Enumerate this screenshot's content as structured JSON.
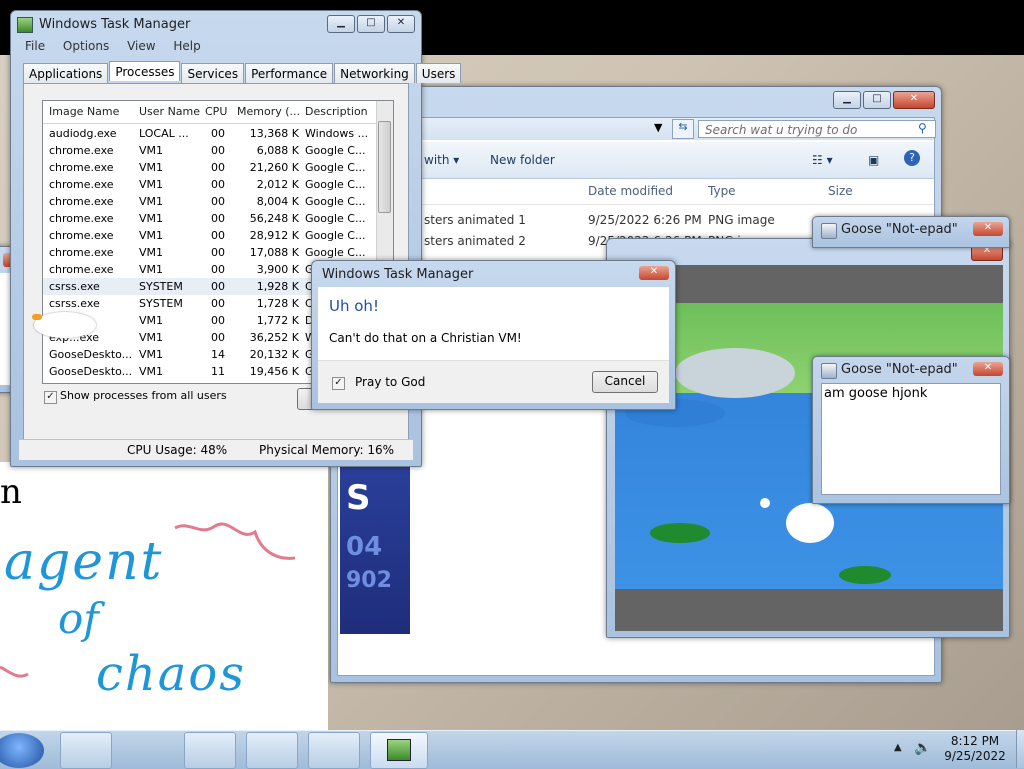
{
  "taskmgr": {
    "title": "Windows Task Manager",
    "menu": [
      "File",
      "Options",
      "View",
      "Help"
    ],
    "tabs": [
      "Applications",
      "Processes",
      "Services",
      "Performance",
      "Networking",
      "Users"
    ],
    "columns": [
      "Image Name",
      "User Name",
      "CPU",
      "Memory (...",
      "Description"
    ],
    "rows": [
      [
        "audiodg.exe",
        "LOCAL ...",
        "00",
        "13,368 K",
        "Windows ..."
      ],
      [
        "chrome.exe",
        "VM1",
        "00",
        "6,088 K",
        "Google C..."
      ],
      [
        "chrome.exe",
        "VM1",
        "00",
        "21,260 K",
        "Google C..."
      ],
      [
        "chrome.exe",
        "VM1",
        "00",
        "2,012 K",
        "Google C..."
      ],
      [
        "chrome.exe",
        "VM1",
        "00",
        "8,004 K",
        "Google C..."
      ],
      [
        "chrome.exe",
        "VM1",
        "00",
        "56,248 K",
        "Google C..."
      ],
      [
        "chrome.exe",
        "VM1",
        "00",
        "28,912 K",
        "Google C..."
      ],
      [
        "chrome.exe",
        "VM1",
        "00",
        "17,088 K",
        "Google C..."
      ],
      [
        "chrome.exe",
        "VM1",
        "00",
        "3,900 K",
        "G"
      ],
      [
        "csrss.exe",
        "SYSTEM",
        "00",
        "1,928 K",
        "C"
      ],
      [
        "csrss.exe",
        "SYSTEM",
        "00",
        "1,728 K",
        "C"
      ],
      [
        "",
        "VM1",
        "00",
        "1,772 K",
        "D"
      ],
      [
        "exp...exe",
        "VM1",
        "00",
        "36,252 K",
        "W"
      ],
      [
        "GooseDeskto...",
        "VM1",
        "14",
        "20,132 K",
        "G"
      ],
      [
        "GooseDeskto...",
        "VM1",
        "11",
        "19,456 K",
        "G"
      ]
    ],
    "show_all_label": "Show processes from all users",
    "cpu_usage": "CPU Usage: 48%",
    "physical_memory": "Physical Memory: 16%"
  },
  "dialog": {
    "title": "Windows Task Manager",
    "heading": "Uh oh!",
    "message": "Can't do that on a Christian VM!",
    "checkbox_label": "Pray to God",
    "cancel_label": "Cancel"
  },
  "explorer": {
    "search_placeholder": "Search wat u trying to do",
    "toolbar": {
      "with_label": "with",
      "new_folder": "New folder"
    },
    "columns": [
      "Date modified",
      "Type",
      "Size"
    ],
    "files": [
      {
        "name": "sters animated 1",
        "date": "9/25/2022 6:26 PM",
        "type": "PNG image"
      },
      {
        "name": "sters animated 2",
        "date": "9/25/2022 6:26 PM",
        "type": "PNG i"
      }
    ]
  },
  "notepad_back": {
    "title": "Goose \"Not-epad\""
  },
  "notepad_front": {
    "title": "Goose \"Not-epad\"",
    "text": "am goose hjonk"
  },
  "drawing": {
    "words": [
      "n",
      "agent",
      "of",
      "chaos"
    ]
  },
  "blue_panel": {
    "letter": "S",
    "num1": "04",
    "num2": "902"
  },
  "taskbar": {
    "time": "8:12 PM",
    "date": "9/25/2022"
  },
  "colors": {
    "accent": "#1f5fa6",
    "close_red": "#c5462e",
    "pond_blue": "#2f7fd6"
  }
}
